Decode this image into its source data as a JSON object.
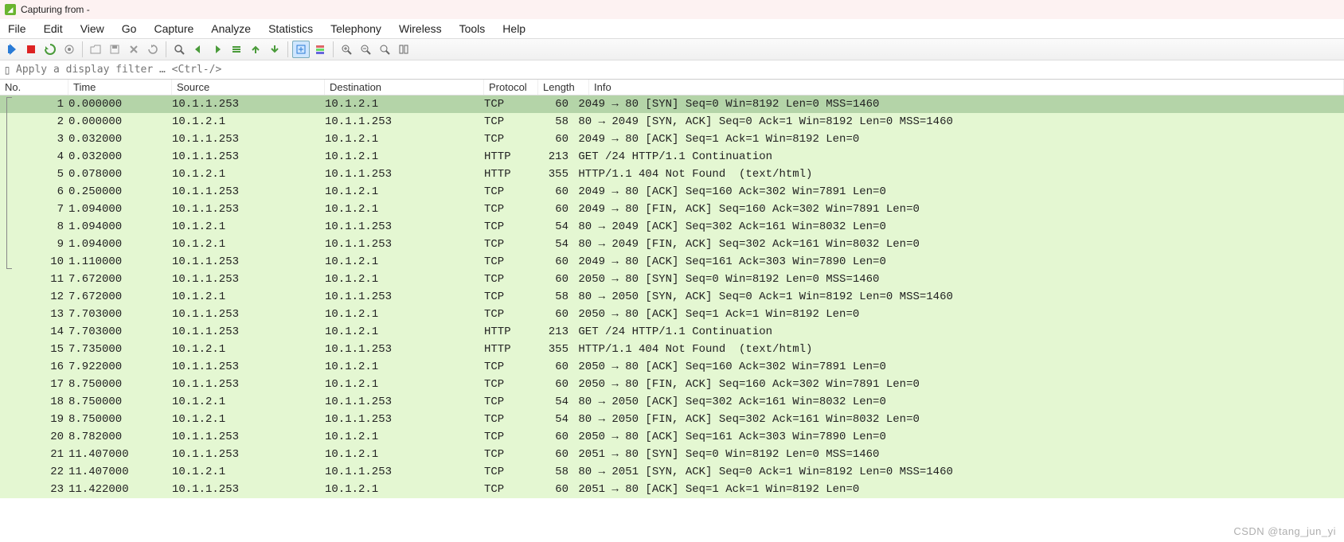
{
  "title": "Capturing from -",
  "menu": [
    "File",
    "Edit",
    "View",
    "Go",
    "Capture",
    "Analyze",
    "Statistics",
    "Telephony",
    "Wireless",
    "Tools",
    "Help"
  ],
  "filter_placeholder": "Apply a display filter … <Ctrl-/>",
  "columns": [
    "No.",
    "Time",
    "Source",
    "Destination",
    "Protocol",
    "Length",
    "Info"
  ],
  "watermark": "CSDN @tang_jun_yi",
  "packets": [
    {
      "no": 1,
      "time": "0.000000",
      "src": "10.1.1.253",
      "dst": "10.1.2.1",
      "proto": "TCP",
      "len": 60,
      "info": "2049 → 80 [SYN] Seq=0 Win=8192 Len=0 MSS=1460",
      "sel": true
    },
    {
      "no": 2,
      "time": "0.000000",
      "src": "10.1.2.1",
      "dst": "10.1.1.253",
      "proto": "TCP",
      "len": 58,
      "info": "80 → 2049 [SYN, ACK] Seq=0 Ack=1 Win=8192 Len=0 MSS=1460"
    },
    {
      "no": 3,
      "time": "0.032000",
      "src": "10.1.1.253",
      "dst": "10.1.2.1",
      "proto": "TCP",
      "len": 60,
      "info": "2049 → 80 [ACK] Seq=1 Ack=1 Win=8192 Len=0"
    },
    {
      "no": 4,
      "time": "0.032000",
      "src": "10.1.1.253",
      "dst": "10.1.2.1",
      "proto": "HTTP",
      "len": 213,
      "info": "GET /24 HTTP/1.1 Continuation"
    },
    {
      "no": 5,
      "time": "0.078000",
      "src": "10.1.2.1",
      "dst": "10.1.1.253",
      "proto": "HTTP",
      "len": 355,
      "info": "HTTP/1.1 404 Not Found  (text/html)"
    },
    {
      "no": 6,
      "time": "0.250000",
      "src": "10.1.1.253",
      "dst": "10.1.2.1",
      "proto": "TCP",
      "len": 60,
      "info": "2049 → 80 [ACK] Seq=160 Ack=302 Win=7891 Len=0"
    },
    {
      "no": 7,
      "time": "1.094000",
      "src": "10.1.1.253",
      "dst": "10.1.2.1",
      "proto": "TCP",
      "len": 60,
      "info": "2049 → 80 [FIN, ACK] Seq=160 Ack=302 Win=7891 Len=0"
    },
    {
      "no": 8,
      "time": "1.094000",
      "src": "10.1.2.1",
      "dst": "10.1.1.253",
      "proto": "TCP",
      "len": 54,
      "info": "80 → 2049 [ACK] Seq=302 Ack=161 Win=8032 Len=0"
    },
    {
      "no": 9,
      "time": "1.094000",
      "src": "10.1.2.1",
      "dst": "10.1.1.253",
      "proto": "TCP",
      "len": 54,
      "info": "80 → 2049 [FIN, ACK] Seq=302 Ack=161 Win=8032 Len=0"
    },
    {
      "no": 10,
      "time": "1.110000",
      "src": "10.1.1.253",
      "dst": "10.1.2.1",
      "proto": "TCP",
      "len": 60,
      "info": "2049 → 80 [ACK] Seq=161 Ack=303 Win=7890 Len=0"
    },
    {
      "no": 11,
      "time": "7.672000",
      "src": "10.1.1.253",
      "dst": "10.1.2.1",
      "proto": "TCP",
      "len": 60,
      "info": "2050 → 80 [SYN] Seq=0 Win=8192 Len=0 MSS=1460"
    },
    {
      "no": 12,
      "time": "7.672000",
      "src": "10.1.2.1",
      "dst": "10.1.1.253",
      "proto": "TCP",
      "len": 58,
      "info": "80 → 2050 [SYN, ACK] Seq=0 Ack=1 Win=8192 Len=0 MSS=1460"
    },
    {
      "no": 13,
      "time": "7.703000",
      "src": "10.1.1.253",
      "dst": "10.1.2.1",
      "proto": "TCP",
      "len": 60,
      "info": "2050 → 80 [ACK] Seq=1 Ack=1 Win=8192 Len=0"
    },
    {
      "no": 14,
      "time": "7.703000",
      "src": "10.1.1.253",
      "dst": "10.1.2.1",
      "proto": "HTTP",
      "len": 213,
      "info": "GET /24 HTTP/1.1 Continuation"
    },
    {
      "no": 15,
      "time": "7.735000",
      "src": "10.1.2.1",
      "dst": "10.1.1.253",
      "proto": "HTTP",
      "len": 355,
      "info": "HTTP/1.1 404 Not Found  (text/html)"
    },
    {
      "no": 16,
      "time": "7.922000",
      "src": "10.1.1.253",
      "dst": "10.1.2.1",
      "proto": "TCP",
      "len": 60,
      "info": "2050 → 80 [ACK] Seq=160 Ack=302 Win=7891 Len=0"
    },
    {
      "no": 17,
      "time": "8.750000",
      "src": "10.1.1.253",
      "dst": "10.1.2.1",
      "proto": "TCP",
      "len": 60,
      "info": "2050 → 80 [FIN, ACK] Seq=160 Ack=302 Win=7891 Len=0"
    },
    {
      "no": 18,
      "time": "8.750000",
      "src": "10.1.2.1",
      "dst": "10.1.1.253",
      "proto": "TCP",
      "len": 54,
      "info": "80 → 2050 [ACK] Seq=302 Ack=161 Win=8032 Len=0"
    },
    {
      "no": 19,
      "time": "8.750000",
      "src": "10.1.2.1",
      "dst": "10.1.1.253",
      "proto": "TCP",
      "len": 54,
      "info": "80 → 2050 [FIN, ACK] Seq=302 Ack=161 Win=8032 Len=0"
    },
    {
      "no": 20,
      "time": "8.782000",
      "src": "10.1.1.253",
      "dst": "10.1.2.1",
      "proto": "TCP",
      "len": 60,
      "info": "2050 → 80 [ACK] Seq=161 Ack=303 Win=7890 Len=0"
    },
    {
      "no": 21,
      "time": "11.407000",
      "src": "10.1.1.253",
      "dst": "10.1.2.1",
      "proto": "TCP",
      "len": 60,
      "info": "2051 → 80 [SYN] Seq=0 Win=8192 Len=0 MSS=1460"
    },
    {
      "no": 22,
      "time": "11.407000",
      "src": "10.1.2.1",
      "dst": "10.1.1.253",
      "proto": "TCP",
      "len": 58,
      "info": "80 → 2051 [SYN, ACK] Seq=0 Ack=1 Win=8192 Len=0 MSS=1460"
    },
    {
      "no": 23,
      "time": "11.422000",
      "src": "10.1.1.253",
      "dst": "10.1.2.1",
      "proto": "TCP",
      "len": 60,
      "info": "2051 → 80 [ACK] Seq=1 Ack=1 Win=8192 Len=0"
    }
  ]
}
